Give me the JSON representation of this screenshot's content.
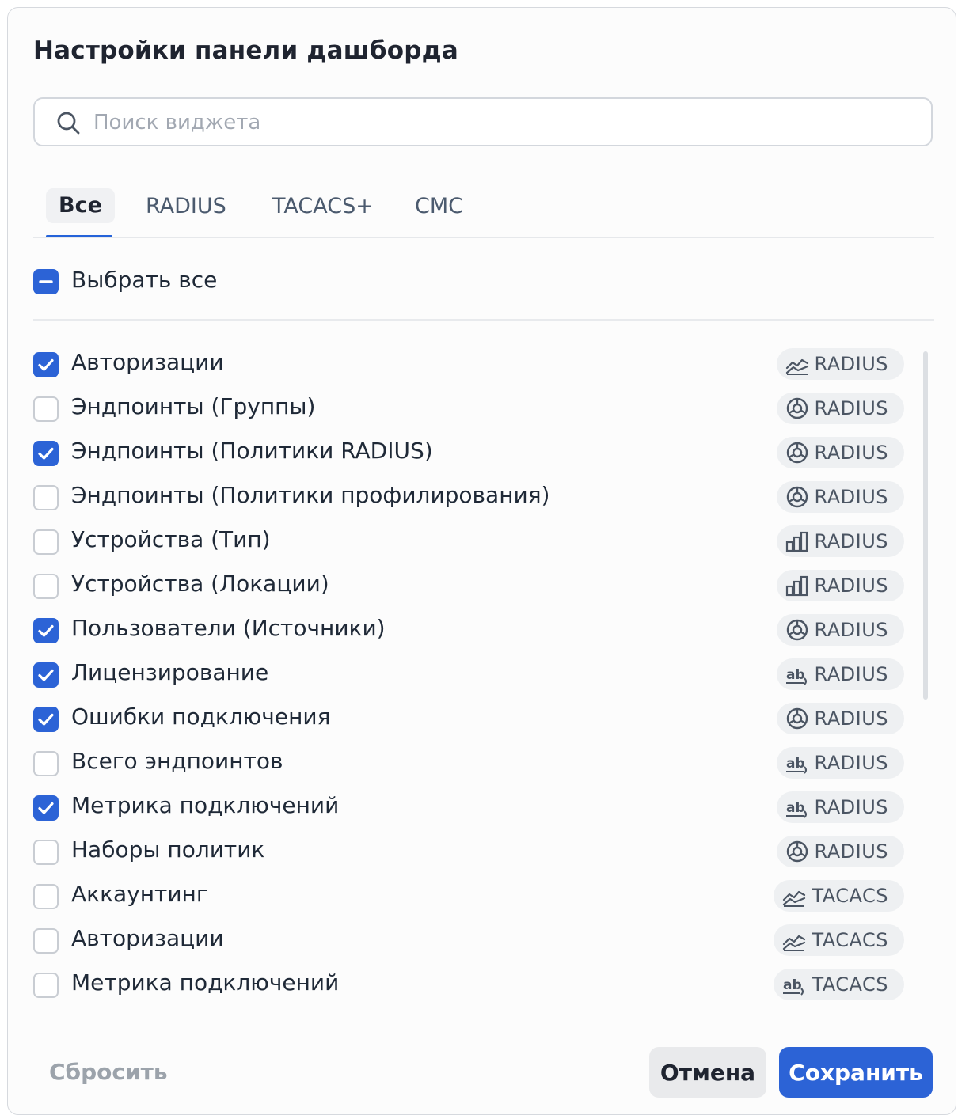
{
  "dialog": {
    "title": "Настройки панели дашборда"
  },
  "search": {
    "placeholder": "Поиск виджета",
    "value": ""
  },
  "tabs": [
    {
      "label": "Все",
      "active": true
    },
    {
      "label": "RADIUS",
      "active": false
    },
    {
      "label": "TACACS+",
      "active": false
    },
    {
      "label": "CMC",
      "active": false
    }
  ],
  "select_all": {
    "label": "Выбрать все",
    "state": "indeterminate"
  },
  "widgets": [
    {
      "label": "Авторизации",
      "checked": true,
      "badge_icon": "line-chart-icon",
      "badge": "RADIUS"
    },
    {
      "label": "Эндпоинты (Группы)",
      "checked": false,
      "badge_icon": "pie-chart-icon",
      "badge": "RADIUS"
    },
    {
      "label": "Эндпоинты (Политики RADIUS)",
      "checked": true,
      "badge_icon": "pie-chart-icon",
      "badge": "RADIUS"
    },
    {
      "label": "Эндпоинты (Политики профилирования)",
      "checked": false,
      "badge_icon": "pie-chart-icon",
      "badge": "RADIUS"
    },
    {
      "label": "Устройства (Тип)",
      "checked": false,
      "badge_icon": "bar-chart-icon",
      "badge": "RADIUS"
    },
    {
      "label": "Устройства (Локации)",
      "checked": false,
      "badge_icon": "bar-chart-icon",
      "badge": "RADIUS"
    },
    {
      "label": "Пользователи (Источники)",
      "checked": true,
      "badge_icon": "pie-chart-icon",
      "badge": "RADIUS"
    },
    {
      "label": "Лицензирование",
      "checked": true,
      "badge_icon": "text-value-icon",
      "badge": "RADIUS"
    },
    {
      "label": "Ошибки подключения",
      "checked": true,
      "badge_icon": "pie-chart-icon",
      "badge": "RADIUS"
    },
    {
      "label": "Всего эндпоинтов",
      "checked": false,
      "badge_icon": "text-value-icon",
      "badge": "RADIUS"
    },
    {
      "label": "Метрика подключений",
      "checked": true,
      "badge_icon": "text-value-icon",
      "badge": "RADIUS"
    },
    {
      "label": "Наборы политик",
      "checked": false,
      "badge_icon": "pie-chart-icon",
      "badge": "RADIUS"
    },
    {
      "label": "Аккаунтинг",
      "checked": false,
      "badge_icon": "line-chart-icon",
      "badge": "TACACS"
    },
    {
      "label": "Авторизации",
      "checked": false,
      "badge_icon": "line-chart-icon",
      "badge": "TACACS"
    },
    {
      "label": "Метрика подключений",
      "checked": false,
      "badge_icon": "text-value-icon",
      "badge": "TACACS"
    }
  ],
  "footer": {
    "reset_label": "Сбросить",
    "cancel_label": "Отмена",
    "save_label": "Сохранить"
  },
  "colors": {
    "accent": "#2c63d6",
    "badge_bg": "#eef0f2"
  }
}
